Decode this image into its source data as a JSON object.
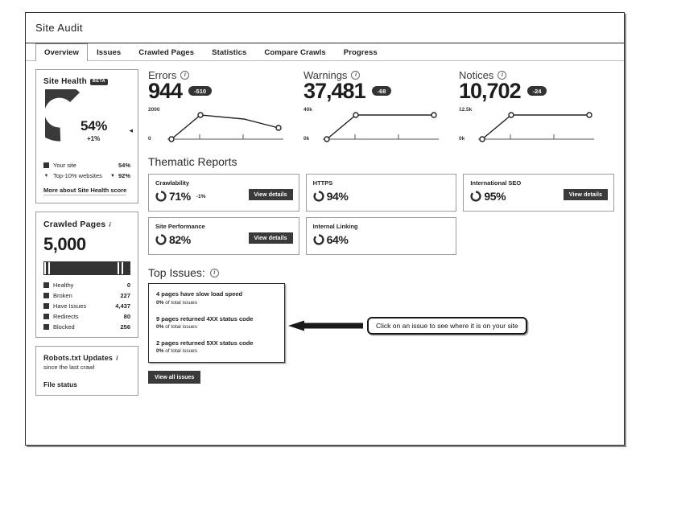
{
  "window": {
    "title": "Site Audit"
  },
  "tabs": [
    {
      "label": "Overview",
      "active": true
    },
    {
      "label": "Issues",
      "active": false
    },
    {
      "label": "Crawled Pages",
      "active": false
    },
    {
      "label": "Statistics",
      "active": false
    },
    {
      "label": "Compare Crawls",
      "active": false
    },
    {
      "label": "Progress",
      "active": false
    }
  ],
  "site_health": {
    "title": "Site Health",
    "badge": "BETA",
    "score": "54%",
    "delta": "+1%",
    "collapse_icon": "triangle-left-icon",
    "legend": [
      {
        "label": "Your site",
        "value": "54%",
        "marker": "swatch"
      },
      {
        "label": "Top-10% websites",
        "value": "92%",
        "marker": "caret",
        "chevron": "⌄"
      }
    ],
    "link": "More about Site Health score"
  },
  "crawled_pages": {
    "title": "Crawled Pages",
    "info_icon": "info-icon",
    "count": "5,000",
    "legend": [
      {
        "label": "Healthy",
        "value": "0"
      },
      {
        "label": "Broken",
        "value": "227"
      },
      {
        "label": "Have Issues",
        "value": "4,437"
      },
      {
        "label": "Redirects",
        "value": "80"
      },
      {
        "label": "Blocked",
        "value": "256"
      }
    ]
  },
  "robots": {
    "title": "Robots.txt Updates",
    "info_icon": "info-icon",
    "subtitle": "since the last crawl",
    "file_status": "File status"
  },
  "metrics": [
    {
      "name": "Errors",
      "info_icon": "info-icon",
      "value": "944",
      "badge": "-510",
      "y_max": "2000",
      "y_min": "0"
    },
    {
      "name": "Warnings",
      "info_icon": "info-icon",
      "value": "37,481",
      "badge": "-68",
      "y_max": "40k",
      "y_min": "0k"
    },
    {
      "name": "Notices",
      "info_icon": "info-icon",
      "value": "10,702",
      "badge": "-24",
      "y_max": "12.5k",
      "y_min": "0k"
    }
  ],
  "thematic": {
    "title": "Thematic Reports",
    "button_label": "View details",
    "cards": [
      {
        "name": "Crawlability",
        "pct": "71%",
        "delta": "-1%",
        "has_button": true
      },
      {
        "name": "HTTPS",
        "pct": "94%",
        "delta": "",
        "has_button": false
      },
      {
        "name": "International SEO",
        "pct": "95%",
        "delta": "",
        "has_button": true
      },
      {
        "name": "Site Performance",
        "pct": "82%",
        "delta": "",
        "has_button": true
      },
      {
        "name": "Internal Linking",
        "pct": "64%",
        "delta": "",
        "has_button": false
      }
    ]
  },
  "top_issues": {
    "title": "Top Issues:",
    "info_icon": "info-icon",
    "items": [
      {
        "text": "4 pages have slow load speed",
        "pct": "0%",
        "sub": "of total issues"
      },
      {
        "text": "9 pages returned 4XX status code",
        "pct": "0%",
        "sub": "of total issues"
      },
      {
        "text": "2 pages returned 5XX status code",
        "pct": "0%",
        "sub": "of total issues"
      }
    ],
    "view_all_label": "View all issues"
  },
  "callout": {
    "text": "Click on an issue to see where it is on your site",
    "arrow_icon": "arrow-left-icon"
  },
  "chart_data": [
    {
      "type": "line",
      "title": "Errors",
      "x": [
        0,
        1,
        2,
        3
      ],
      "values": [
        0,
        1450,
        1330,
        944
      ],
      "ylim": [
        0,
        2000
      ],
      "ylabel": "",
      "xlabel": "",
      "tick_labels": [
        "2000",
        "0"
      ],
      "grid": false,
      "legend": "none"
    },
    {
      "type": "line",
      "title": "Warnings",
      "x": [
        0,
        1,
        2,
        3
      ],
      "values": [
        0,
        37550,
        37500,
        37481
      ],
      "ylim": [
        0,
        40000
      ],
      "ylabel": "",
      "xlabel": "",
      "tick_labels": [
        "40k",
        "0k"
      ],
      "grid": false,
      "legend": "none"
    },
    {
      "type": "line",
      "title": "Notices",
      "x": [
        0,
        1,
        2,
        3
      ],
      "values": [
        0,
        10750,
        10720,
        10702
      ],
      "ylim": [
        0,
        12500
      ],
      "ylabel": "",
      "xlabel": "",
      "tick_labels": [
        "12.5k",
        "0k"
      ],
      "grid": false,
      "legend": "none"
    },
    {
      "type": "pie",
      "title": "Site Health",
      "labels": [
        "Your site",
        "Remaining"
      ],
      "values": [
        54,
        46
      ],
      "display_value": "54%"
    },
    {
      "type": "bar",
      "title": "Crawled Pages",
      "categories": [
        "Healthy",
        "Broken",
        "Have Issues",
        "Redirects",
        "Blocked"
      ],
      "values": [
        0,
        227,
        4437,
        80,
        256
      ],
      "total": 5000,
      "stacked": true
    }
  ],
  "colors": {
    "ink": "#1d1d1d",
    "dark_fill": "#333333",
    "panel_border": "#9d9d9d",
    "button_bg": "#3a3a3a"
  }
}
